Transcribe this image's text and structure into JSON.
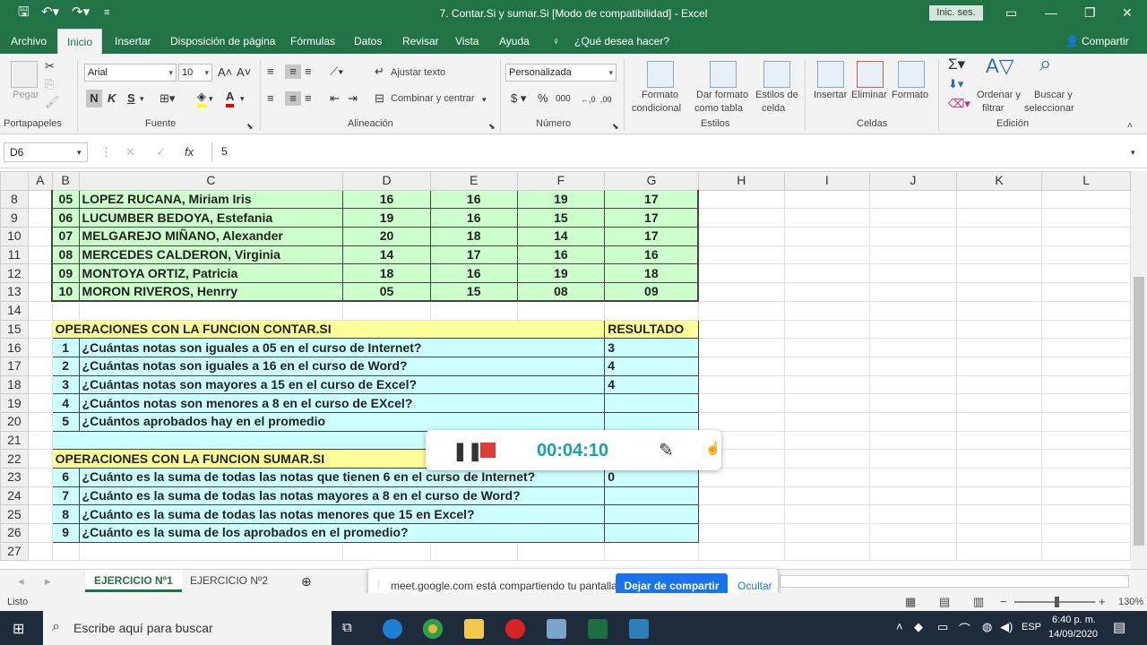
{
  "title": "7. Contar.Si y sumar.Si  [Modo de compatibilidad]  -  Excel",
  "signin": "Inic. ses.",
  "menu": [
    "Archivo",
    "Inicio",
    "Insertar",
    "Disposición de página",
    "Fórmulas",
    "Datos",
    "Revisar",
    "Vista",
    "Ayuda",
    "¿Qué desea hacer?"
  ],
  "share_btn": "Compartir",
  "ribbon": {
    "paste": "Pegar",
    "font": "Arial",
    "size": "10",
    "wrap": "Ajustar texto",
    "merge": "Combinar y centrar",
    "number_format": "Personalizada",
    "bold": "N",
    "italic": "K",
    "underline": "S",
    "cond1": "Formato",
    "cond2": "condicional",
    "table1": "Dar formato",
    "table2": "como tabla",
    "styles1": "Estilos de",
    "styles2": "celda",
    "insert": "Insertar",
    "delete": "Eliminar",
    "format": "Formato",
    "sort1": "Ordenar y",
    "sort2": "filtrar",
    "find1": "Buscar y",
    "find2": "seleccionar",
    "groups": {
      "clipboard": "Portapapeles",
      "font": "Fuente",
      "align": "Alineación",
      "number": "Número",
      "styles": "Estilos",
      "cells": "Celdas",
      "edit": "Edición"
    }
  },
  "namebox": "D6",
  "formula": "5",
  "columns": [
    "A",
    "B",
    "C",
    "D",
    "E",
    "F",
    "G",
    "H",
    "I",
    "J",
    "K",
    "L"
  ],
  "students": [
    {
      "row": "8",
      "n": "05",
      "name": "LOPEZ RUCANA, Miriam Iris",
      "d": "16",
      "e": "16",
      "f": "19",
      "g": "17"
    },
    {
      "row": "9",
      "n": "06",
      "name": "LUCUMBER BEDOYA, Estefania",
      "d": "19",
      "e": "16",
      "f": "15",
      "g": "17"
    },
    {
      "row": "10",
      "n": "07",
      "name": "MELGAREJO MIÑANO, Alexander",
      "d": "20",
      "e": "18",
      "f": "14",
      "g": "17"
    },
    {
      "row": "11",
      "n": "08",
      "name": "MERCEDES CALDERON, Virginia",
      "d": "14",
      "e": "17",
      "f": "16",
      "g": "16"
    },
    {
      "row": "12",
      "n": "09",
      "name": "MONTOYA ORTIZ, Patricia",
      "d": "18",
      "e": "16",
      "f": "19",
      "g": "18"
    },
    {
      "row": "13",
      "n": "10",
      "name": "MORON RIVEROS, Henrry",
      "d": "05",
      "e": "15",
      "f": "08",
      "g": "09"
    }
  ],
  "rows_extra": {
    "r14": "14",
    "r15": "15",
    "r21": "21",
    "r22": "22",
    "r27": "27"
  },
  "contar": {
    "header": "OPERACIONES CON LA FUNCION CONTAR.SI",
    "result_header": "RESULTADO",
    "items": [
      {
        "row": "16",
        "n": "1",
        "q": "¿Cuántas notas son iguales a 05 en el curso de Internet?",
        "r": "3"
      },
      {
        "row": "17",
        "n": "2",
        "q": "¿Cuántas notas son iguales a 16 en el curso de Word?",
        "r": "4"
      },
      {
        "row": "18",
        "n": "3",
        "q": "¿Cuántas notas son mayores a 15 en el curso de Excel?",
        "r": "4"
      },
      {
        "row": "19",
        "n": "4",
        "q": "¿Cuántos notas son menores a 8 en el curso de EXcel?",
        "r": ""
      },
      {
        "row": "20",
        "n": "5",
        "q": "¿Cuántos aprobados hay en el promedio",
        "r": ""
      }
    ]
  },
  "sumar": {
    "header": "OPERACIONES CON LA FUNCION SUMAR.SI",
    "items": [
      {
        "row": "23",
        "n": "6",
        "q": "¿Cuánto es la suma  de todas las notas que tienen  6 en el curso de Internet?",
        "r": "0"
      },
      {
        "row": "24",
        "n": "7",
        "q": "¿Cuánto es la suma de todas las notas mayores a 8 en el curso de Word?",
        "r": ""
      },
      {
        "row": "25",
        "n": "8",
        "q": "¿Cuánto es la suma de todas las notas menores que 15 en Excel?",
        "r": ""
      },
      {
        "row": "26",
        "n": "9",
        "q": "¿Cuánto es la suma de los aprobados en el promedio?",
        "r": ""
      }
    ]
  },
  "sheets": [
    "EJERCICIO Nº1",
    "EJERCICIO Nº2"
  ],
  "status": {
    "ready": "Listo",
    "zoom": "130%"
  },
  "recorder": {
    "time": "00:04:10"
  },
  "share": {
    "text": "meet.google.com está compartiendo tu pantalla.",
    "stop": "Dejar de compartir",
    "hide": "Ocultar"
  },
  "taskbar": {
    "search": "Escribe aquí para buscar",
    "lang": "ESP",
    "time": "6:40 p. m.",
    "date": "14/09/2020"
  },
  "colors": {
    "excel_green": "#217346",
    "cell_green": "#ccffcc",
    "cell_yellow": "#ffff99",
    "cell_cyan": "#ccffff",
    "timer": "#1aa0b3",
    "meet_blue": "#1a73e8"
  }
}
